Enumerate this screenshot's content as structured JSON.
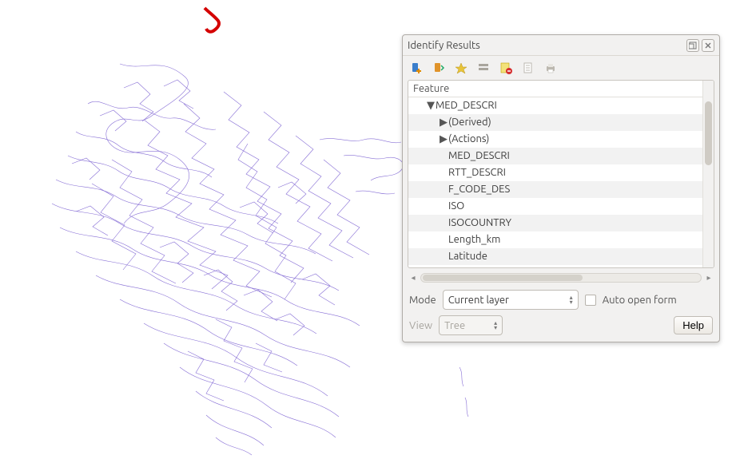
{
  "panel": {
    "title": "Identify Results",
    "tree_header": "Feature",
    "rows": [
      {
        "label": "MED_DESCRI",
        "twisty": "▼",
        "indent": "indent1",
        "striped": false
      },
      {
        "label": "(Derived)",
        "twisty": "▶",
        "indent": "indent2",
        "striped": true
      },
      {
        "label": "(Actions)",
        "twisty": "▶",
        "indent": "indent2",
        "striped": false
      },
      {
        "label": "MED_DESCRI",
        "twisty": "",
        "indent": "indent2b",
        "striped": true
      },
      {
        "label": "RTT_DESCRI",
        "twisty": "",
        "indent": "indent2b",
        "striped": false
      },
      {
        "label": "F_CODE_DES",
        "twisty": "",
        "indent": "indent2b",
        "striped": true
      },
      {
        "label": "ISO",
        "twisty": "",
        "indent": "indent2b",
        "striped": false
      },
      {
        "label": "ISOCOUNTRY",
        "twisty": "",
        "indent": "indent2b",
        "striped": true
      },
      {
        "label": "Length_km",
        "twisty": "",
        "indent": "indent2b",
        "striped": false
      },
      {
        "label": "Latitude",
        "twisty": "",
        "indent": "indent2b",
        "striped": true
      }
    ],
    "mode_label": "Mode",
    "mode_value": "Current layer",
    "auto_open_label": "Auto open form",
    "view_label": "View",
    "view_value": "Tree",
    "help_label": "Help"
  },
  "toolbar_icons": [
    "expand-new-results-icon",
    "collapse-tree-icon",
    "expand-tree-icon",
    "view-form-icon",
    "clear-results-icon",
    "copy-feature-icon",
    "print-icon"
  ]
}
